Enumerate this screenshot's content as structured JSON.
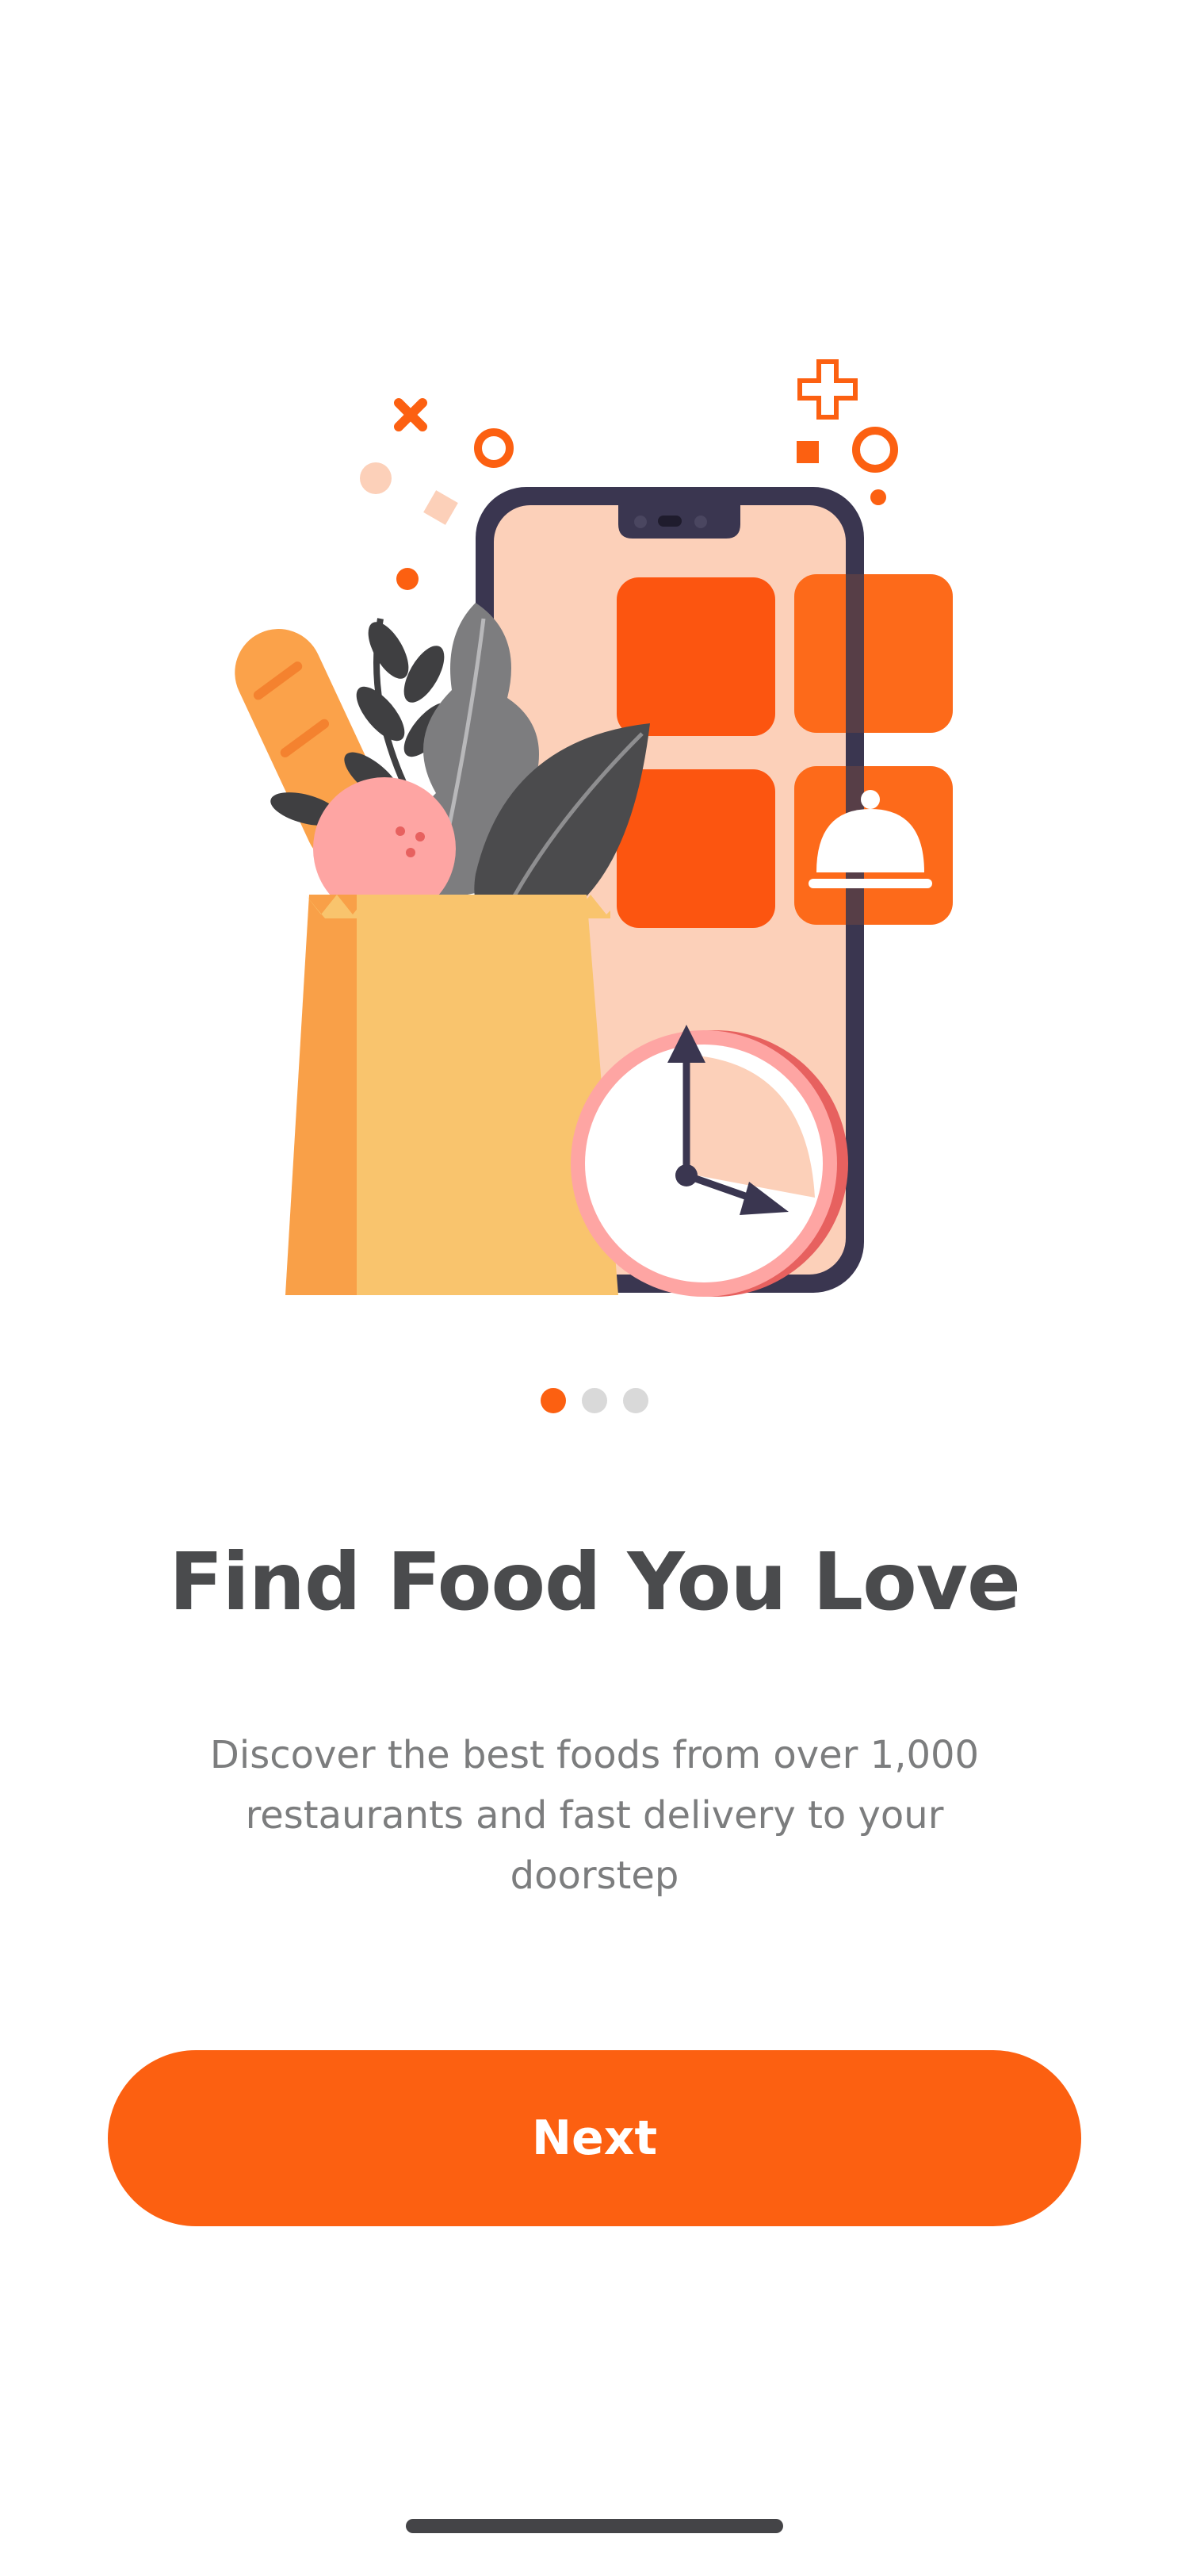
{
  "onboarding": {
    "title": "Find Food You Love",
    "description": "Discover the best foods from over 1,000 restaurants and fast delivery to your doorstep",
    "next_label": "Next",
    "current_page": 1,
    "total_pages": 3
  },
  "illustration": {
    "icons": [
      "grocery-bag-icon",
      "phone-icon",
      "clock-icon",
      "food-cloche-icon"
    ]
  },
  "colors": {
    "accent": "#fc6011",
    "title": "#4a4b4d",
    "body_text": "#7c7d7e",
    "inactive_dot": "#d9d9d9"
  }
}
